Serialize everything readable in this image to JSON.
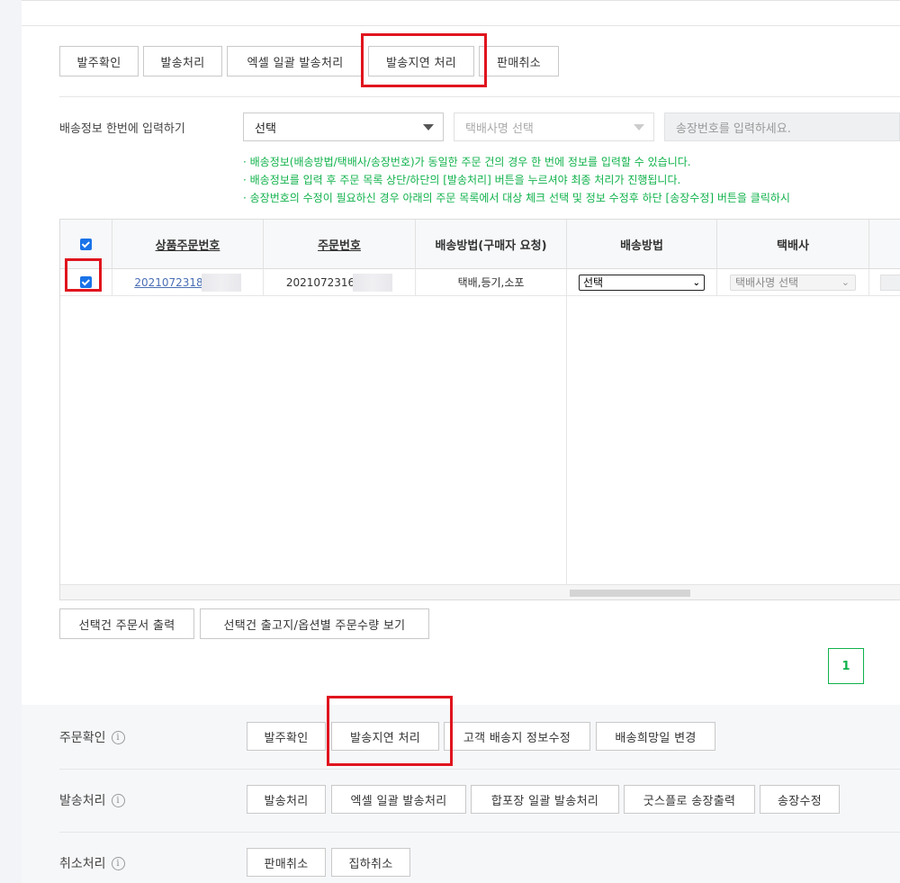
{
  "top_actions": [
    "발주확인",
    "발송처리",
    "엑셀 일괄 발송처리",
    "발송지연 처리",
    "판매취소"
  ],
  "bulk_input": {
    "label": "배송정보 한번에 입력하기",
    "method_select": "선택",
    "courier_select": "택배사명 선택",
    "tracking_placeholder": "송장번호를 입력하세요."
  },
  "notes": [
    "· 배송정보(배송방법/택배사/송장번호)가 동일한 주문 건의 경우 한 번에 정보를 입력할 수 있습니다.",
    "· 배송정보를 입력 후 주문 목록 상단/하단의 [발송처리] 버튼을 누르셔야 최종 처리가 진행됩니다.",
    "· 송장번호의 수정이 필요하신 경우 아래의 주문 목록에서 대상 체크 선택 및 정보 수정후 하단 [송장수정] 버튼을 클릭하시"
  ],
  "table": {
    "headers": [
      "상품주문번호",
      "주문번호",
      "배송방법(구매자 요청)",
      "배송방법",
      "택배사"
    ],
    "rows": [
      {
        "product_order_no": "2021072318",
        "order_no": "2021072316",
        "buyer_method": "택배,등기,소포",
        "method": "선택",
        "courier": "택배사명 선택"
      }
    ]
  },
  "list_actions": [
    "선택건 주문서 출력",
    "선택건 출고지/옵션별 주문수량 보기"
  ],
  "pagination": {
    "current": "1"
  },
  "sections": [
    {
      "label": "주문확인",
      "buttons": [
        "발주확인",
        "발송지연 처리",
        "고객 배송지 정보수정",
        "배송희망일 변경"
      ]
    },
    {
      "label": "발송처리",
      "buttons": [
        "발송처리",
        "엑셀 일괄 발송처리",
        "합포장 일괄 발송처리",
        "굿스플로 송장출력",
        "송장수정"
      ]
    },
    {
      "label": "취소처리",
      "buttons": [
        "판매취소",
        "집하취소"
      ]
    }
  ],
  "info_icon": "info-icon",
  "colors": {
    "accent_green": "#10b24b",
    "highlight_red": "#e0141e",
    "checkbox_blue": "#1a73e8"
  }
}
